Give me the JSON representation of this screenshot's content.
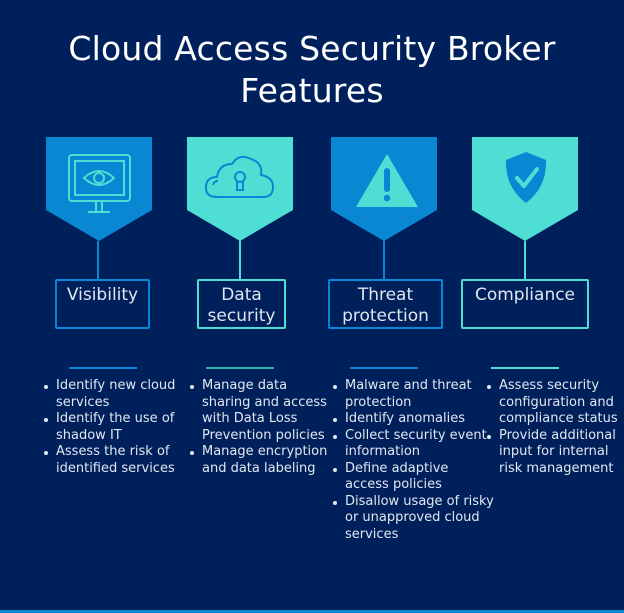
{
  "title": {
    "line1": "Cloud Access Security Broker",
    "line2": "Features"
  },
  "colors": {
    "background": "#00205b",
    "blue": "#0a87d2",
    "teal": "#4fded3"
  },
  "features": [
    {
      "label": "Visibility",
      "icon": "monitor-eye-icon",
      "accent": "blue",
      "bullets": [
        "Identify new cloud services",
        "Identify the use of shadow IT",
        "Assess the risk of identified services"
      ]
    },
    {
      "label": "Data security",
      "icon": "cloud-lock-icon",
      "accent": "teal",
      "bullets": [
        "Manage data sharing and access with Data Loss Prevention policies",
        "Manage encryption and data labeling"
      ]
    },
    {
      "label": "Threat protection",
      "icon": "warning-triangle-icon",
      "accent": "blue",
      "bullets": [
        "Malware and threat protection",
        "Identify anomalies",
        "Collect security event information",
        "Define adaptive access policies",
        "Disallow usage of risky or unapproved cloud services"
      ]
    },
    {
      "label": "Compliance",
      "icon": "shield-check-icon",
      "accent": "teal",
      "bullets": [
        "Assess security configuration and compliance status",
        "Provide additional input for internal risk management"
      ]
    }
  ]
}
